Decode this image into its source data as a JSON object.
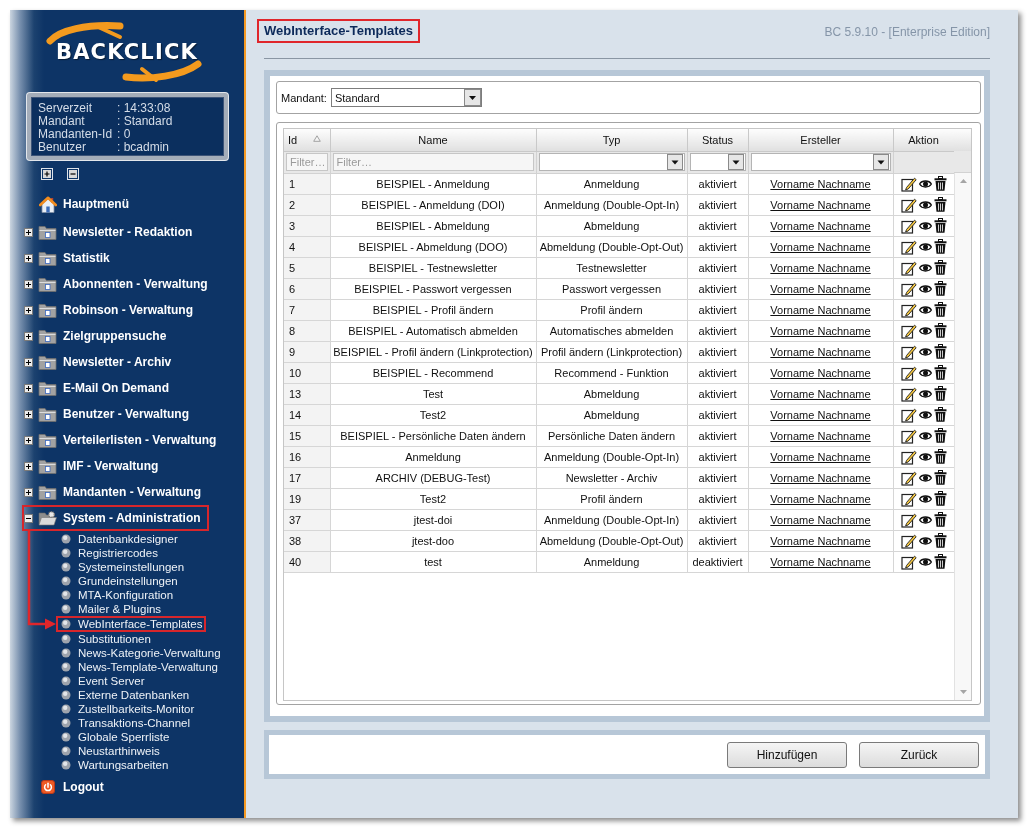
{
  "sidebar": {
    "logo": {
      "text": "BACKCLICK"
    },
    "info": [
      {
        "label": "Serverzeit",
        "value": ": 14:33:08"
      },
      {
        "label": "Mandant",
        "value": ": Standard"
      },
      {
        "label": "Mandanten-Id",
        "value": ": 0"
      },
      {
        "label": "Benutzer",
        "value": ": bcadmin"
      }
    ],
    "menu": [
      {
        "kind": "home",
        "label": "Hauptmenü",
        "highlighted": false
      },
      {
        "kind": "folder",
        "label": "Newsletter - Redaktion",
        "expanded": false,
        "highlighted": false
      },
      {
        "kind": "folder",
        "label": "Statistik",
        "expanded": false,
        "highlighted": false
      },
      {
        "kind": "folder",
        "label": "Abonnenten - Verwaltung",
        "expanded": false,
        "highlighted": false
      },
      {
        "kind": "folder",
        "label": "Robinson - Verwaltung",
        "expanded": false,
        "highlighted": false
      },
      {
        "kind": "folder",
        "label": "Zielgruppensuche",
        "expanded": false,
        "highlighted": false
      },
      {
        "kind": "folder",
        "label": "Newsletter - Archiv",
        "expanded": false,
        "highlighted": false
      },
      {
        "kind": "folder",
        "label": "E-Mail On Demand",
        "expanded": false,
        "highlighted": false
      },
      {
        "kind": "folder",
        "label": "Benutzer - Verwaltung",
        "expanded": false,
        "highlighted": false
      },
      {
        "kind": "folder",
        "label": "Verteilerlisten - Verwaltung",
        "expanded": false,
        "highlighted": false
      },
      {
        "kind": "folder",
        "label": "IMF - Verwaltung",
        "expanded": false,
        "highlighted": false
      },
      {
        "kind": "folder",
        "label": "Mandanten - Verwaltung",
        "expanded": false,
        "highlighted": false
      },
      {
        "kind": "folder",
        "label": "System - Administration",
        "expanded": true,
        "highlighted": true,
        "children": [
          {
            "label": "Datenbankdesigner",
            "highlighted": false
          },
          {
            "label": "Registriercodes",
            "highlighted": false
          },
          {
            "label": "Systemeinstellungen",
            "highlighted": false
          },
          {
            "label": "Grundeinstellungen",
            "highlighted": false
          },
          {
            "label": "MTA-Konfiguration",
            "highlighted": false
          },
          {
            "label": "Mailer & Plugins",
            "highlighted": false
          },
          {
            "label": "WebInterface-Templates",
            "highlighted": true
          },
          {
            "label": "Substitutionen",
            "highlighted": false
          },
          {
            "label": "News-Kategorie-Verwaltung",
            "highlighted": false
          },
          {
            "label": "News-Template-Verwaltung",
            "highlighted": false
          },
          {
            "label": "Event Server",
            "highlighted": false
          },
          {
            "label": "Externe Datenbanken",
            "highlighted": false
          },
          {
            "label": "Zustellbarkeits-Monitor",
            "highlighted": false
          },
          {
            "label": "Transaktions-Channel",
            "highlighted": false
          },
          {
            "label": "Globale Sperrliste",
            "highlighted": false
          },
          {
            "label": "Neustarthinweis",
            "highlighted": false
          },
          {
            "label": "Wartungsarbeiten",
            "highlighted": false
          }
        ]
      },
      {
        "kind": "logout",
        "label": "Logout",
        "highlighted": false
      }
    ]
  },
  "header": {
    "title": "WebInterface-Templates",
    "title_highlighted": true,
    "version": "BC 5.9.10 - [Enterprise Edition]"
  },
  "mandant": {
    "label": "Mandant:",
    "value": "Standard"
  },
  "table": {
    "columns": [
      {
        "label": "Id",
        "sorted": true,
        "filter": {
          "kind": "text",
          "placeholder": "Filter…"
        }
      },
      {
        "label": "Name",
        "sorted": false,
        "filter": {
          "kind": "text",
          "placeholder": "Filter…"
        }
      },
      {
        "label": "Typ",
        "sorted": false,
        "filter": {
          "kind": "select"
        }
      },
      {
        "label": "Status",
        "sorted": false,
        "filter": {
          "kind": "select"
        }
      },
      {
        "label": "Ersteller",
        "sorted": false,
        "filter": {
          "kind": "select"
        }
      },
      {
        "label": "Aktion",
        "sorted": false
      }
    ],
    "rows": [
      {
        "id": "1",
        "name": "BEISPIEL - Anmeldung",
        "typ": "Anmeldung",
        "status": "aktiviert",
        "ersteller": "Vorname Nachname"
      },
      {
        "id": "2",
        "name": "BEISPIEL - Anmeldung (DOI)",
        "typ": "Anmeldung (Double-Opt-In)",
        "status": "aktiviert",
        "ersteller": "Vorname Nachname"
      },
      {
        "id": "3",
        "name": "BEISPIEL - Abmeldung",
        "typ": "Abmeldung",
        "status": "aktiviert",
        "ersteller": "Vorname Nachname"
      },
      {
        "id": "4",
        "name": "BEISPIEL - Abmeldung (DOO)",
        "typ": "Abmeldung (Double-Opt-Out)",
        "status": "aktiviert",
        "ersteller": "Vorname Nachname"
      },
      {
        "id": "5",
        "name": "BEISPIEL - Testnewsletter",
        "typ": "Testnewsletter",
        "status": "aktiviert",
        "ersteller": "Vorname Nachname"
      },
      {
        "id": "6",
        "name": "BEISPIEL - Passwort vergessen",
        "typ": "Passwort vergessen",
        "status": "aktiviert",
        "ersteller": "Vorname Nachname"
      },
      {
        "id": "7",
        "name": "BEISPIEL - Profil ändern",
        "typ": "Profil ändern",
        "status": "aktiviert",
        "ersteller": "Vorname Nachname"
      },
      {
        "id": "8",
        "name": "BEISPIEL - Automatisch abmelden",
        "typ": "Automatisches abmelden",
        "status": "aktiviert",
        "ersteller": "Vorname Nachname"
      },
      {
        "id": "9",
        "name": "BEISPIEL - Profil ändern (Linkprotection)",
        "typ": "Profil ändern (Linkprotection)",
        "status": "aktiviert",
        "ersteller": "Vorname Nachname"
      },
      {
        "id": "10",
        "name": "BEISPIEL - Recommend",
        "typ": "Recommend - Funktion",
        "status": "aktiviert",
        "ersteller": "Vorname Nachname"
      },
      {
        "id": "13",
        "name": "Test",
        "typ": "Abmeldung",
        "status": "aktiviert",
        "ersteller": "Vorname Nachname"
      },
      {
        "id": "14",
        "name": "Test2",
        "typ": "Abmeldung",
        "status": "aktiviert",
        "ersteller": "Vorname Nachname"
      },
      {
        "id": "15",
        "name": "BEISPIEL - Persönliche Daten ändern",
        "typ": "Persönliche Daten ändern",
        "status": "aktiviert",
        "ersteller": "Vorname Nachname"
      },
      {
        "id": "16",
        "name": "Anmeldung",
        "typ": "Anmeldung (Double-Opt-In)",
        "status": "aktiviert",
        "ersteller": "Vorname Nachname"
      },
      {
        "id": "17",
        "name": "ARCHIV (DEBUG-Test)",
        "typ": "Newsletter - Archiv",
        "status": "aktiviert",
        "ersteller": "Vorname Nachname"
      },
      {
        "id": "19",
        "name": "Test2",
        "typ": "Profil ändern",
        "status": "aktiviert",
        "ersteller": "Vorname Nachname"
      },
      {
        "id": "37",
        "name": "jtest-doi",
        "typ": "Anmeldung (Double-Opt-In)",
        "status": "aktiviert",
        "ersteller": "Vorname Nachname"
      },
      {
        "id": "38",
        "name": "jtest-doo",
        "typ": "Abmeldung (Double-Opt-Out)",
        "status": "aktiviert",
        "ersteller": "Vorname Nachname"
      },
      {
        "id": "40",
        "name": "test",
        "typ": "Anmeldung",
        "status": "deaktiviert",
        "ersteller": "Vorname Nachname"
      }
    ]
  },
  "buttons": [
    "Hinzufügen",
    "Zurück"
  ]
}
